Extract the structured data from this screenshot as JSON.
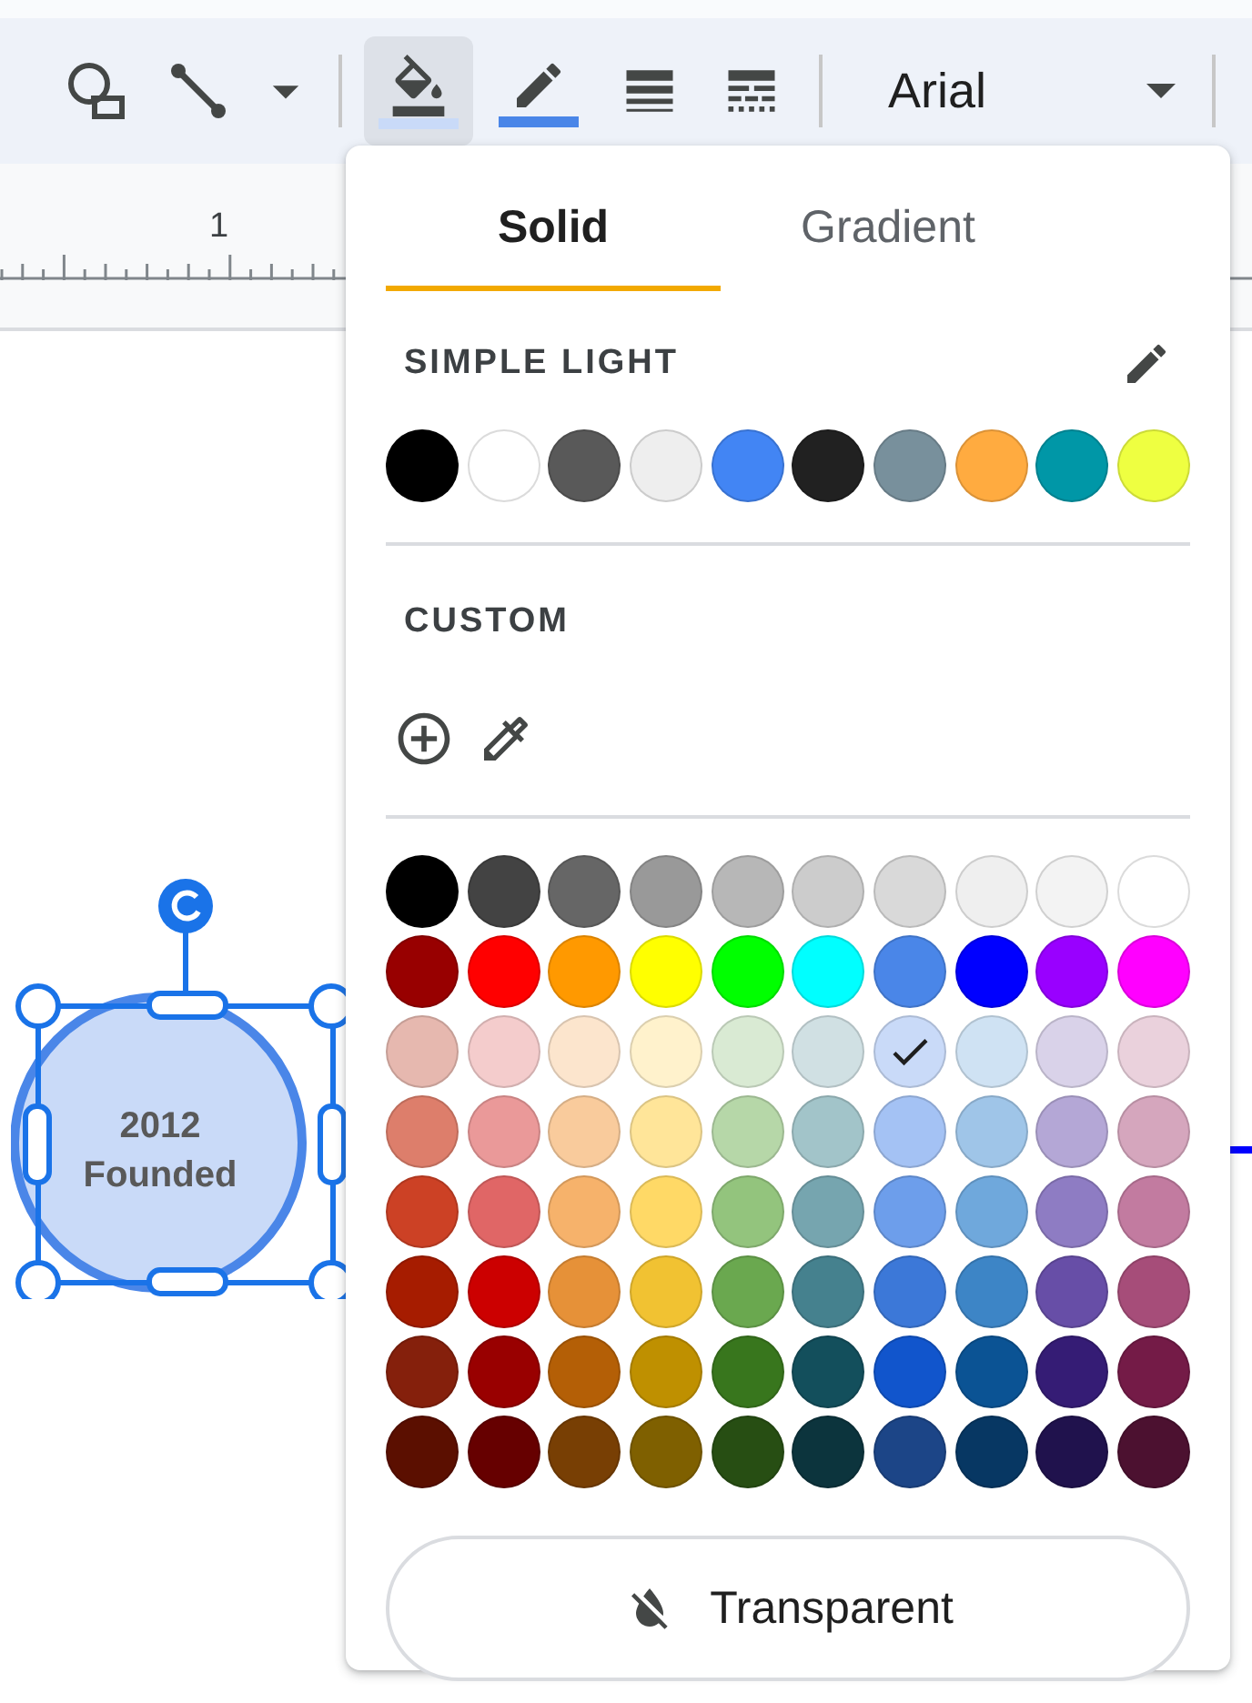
{
  "toolbar": {
    "fill_button": {
      "active": true
    },
    "font": "Arial"
  },
  "ruler": {
    "labels": [
      "1"
    ]
  },
  "shape": {
    "lines": [
      "2012",
      "Founded"
    ],
    "selected": true
  },
  "fill_popup": {
    "tabs": [
      {
        "label": "Solid",
        "selected": true
      },
      {
        "label": "Gradient",
        "selected": false
      }
    ],
    "theme": {
      "title": "SIMPLE LIGHT",
      "colors": [
        {
          "color": "#000000"
        },
        {
          "color": "#ffffff"
        },
        {
          "color": "#595959"
        },
        {
          "color": "#eeeeee"
        },
        {
          "color": "#4285f4"
        },
        {
          "color": "#212121"
        },
        {
          "color": "#78909c"
        },
        {
          "color": "#ffab40"
        },
        {
          "color": "#0097a7"
        },
        {
          "color": "#eeff41"
        }
      ]
    },
    "custom": {
      "title": "CUSTOM"
    },
    "palette": [
      {
        "colors": [
          {
            "color": "#000000",
            "selected": false
          },
          {
            "color": "#434343",
            "selected": false
          },
          {
            "color": "#666666",
            "selected": false
          },
          {
            "color": "#999999",
            "selected": false
          },
          {
            "color": "#b7b7b7",
            "selected": false
          },
          {
            "color": "#cccccc",
            "selected": false
          },
          {
            "color": "#d9d9d9",
            "selected": false
          },
          {
            "color": "#efefef",
            "selected": false
          },
          {
            "color": "#f3f3f3",
            "selected": false
          },
          {
            "color": "#ffffff",
            "selected": false
          }
        ]
      },
      {
        "colors": [
          {
            "color": "#980000",
            "selected": false
          },
          {
            "color": "#ff0000",
            "selected": false
          },
          {
            "color": "#ff9900",
            "selected": false
          },
          {
            "color": "#ffff00",
            "selected": false
          },
          {
            "color": "#00ff00",
            "selected": false
          },
          {
            "color": "#00ffff",
            "selected": false
          },
          {
            "color": "#4a86e8",
            "selected": false
          },
          {
            "color": "#0000ff",
            "selected": false
          },
          {
            "color": "#9900ff",
            "selected": false
          },
          {
            "color": "#ff00ff",
            "selected": false
          }
        ]
      },
      {
        "colors": [
          {
            "color": "#e6b8af",
            "selected": false
          },
          {
            "color": "#f4cccc",
            "selected": false
          },
          {
            "color": "#fce5cd",
            "selected": false
          },
          {
            "color": "#fff2cc",
            "selected": false
          },
          {
            "color": "#d9ead3",
            "selected": false
          },
          {
            "color": "#d0e0e3",
            "selected": false
          },
          {
            "color": "#c9daf8",
            "selected": true
          },
          {
            "color": "#cfe2f3",
            "selected": false
          },
          {
            "color": "#d9d2e9",
            "selected": false
          },
          {
            "color": "#ead1dc",
            "selected": false
          }
        ]
      },
      {
        "colors": [
          {
            "color": "#dd7e6b",
            "selected": false
          },
          {
            "color": "#ea9999",
            "selected": false
          },
          {
            "color": "#f9cb9c",
            "selected": false
          },
          {
            "color": "#ffe599",
            "selected": false
          },
          {
            "color": "#b6d7a8",
            "selected": false
          },
          {
            "color": "#a2c4c9",
            "selected": false
          },
          {
            "color": "#a4c2f4",
            "selected": false
          },
          {
            "color": "#9fc5e8",
            "selected": false
          },
          {
            "color": "#b4a7d6",
            "selected": false
          },
          {
            "color": "#d5a6bd",
            "selected": false
          }
        ]
      },
      {
        "colors": [
          {
            "color": "#cc4125",
            "selected": false
          },
          {
            "color": "#e06666",
            "selected": false
          },
          {
            "color": "#f6b26b",
            "selected": false
          },
          {
            "color": "#ffd966",
            "selected": false
          },
          {
            "color": "#93c47d",
            "selected": false
          },
          {
            "color": "#76a5af",
            "selected": false
          },
          {
            "color": "#6d9eeb",
            "selected": false
          },
          {
            "color": "#6fa8dc",
            "selected": false
          },
          {
            "color": "#8e7cc3",
            "selected": false
          },
          {
            "color": "#c27ba0",
            "selected": false
          }
        ]
      },
      {
        "colors": [
          {
            "color": "#a61c00",
            "selected": false
          },
          {
            "color": "#cc0000",
            "selected": false
          },
          {
            "color": "#e69138",
            "selected": false
          },
          {
            "color": "#f1c232",
            "selected": false
          },
          {
            "color": "#6aa84f",
            "selected": false
          },
          {
            "color": "#45818e",
            "selected": false
          },
          {
            "color": "#3c78d8",
            "selected": false
          },
          {
            "color": "#3d85c6",
            "selected": false
          },
          {
            "color": "#674ea7",
            "selected": false
          },
          {
            "color": "#a64d79",
            "selected": false
          }
        ]
      },
      {
        "colors": [
          {
            "color": "#85200c",
            "selected": false
          },
          {
            "color": "#990000",
            "selected": false
          },
          {
            "color": "#b45f06",
            "selected": false
          },
          {
            "color": "#bf9000",
            "selected": false
          },
          {
            "color": "#38761d",
            "selected": false
          },
          {
            "color": "#134f5c",
            "selected": false
          },
          {
            "color": "#1155cc",
            "selected": false
          },
          {
            "color": "#0b5394",
            "selected": false
          },
          {
            "color": "#351c75",
            "selected": false
          },
          {
            "color": "#741b47",
            "selected": false
          }
        ]
      },
      {
        "colors": [
          {
            "color": "#5b0f00",
            "selected": false
          },
          {
            "color": "#660000",
            "selected": false
          },
          {
            "color": "#783f04",
            "selected": false
          },
          {
            "color": "#7f6000",
            "selected": false
          },
          {
            "color": "#274e13",
            "selected": false
          },
          {
            "color": "#0c343d",
            "selected": false
          },
          {
            "color": "#1c4587",
            "selected": false
          },
          {
            "color": "#073763",
            "selected": false
          },
          {
            "color": "#20124d",
            "selected": false
          },
          {
            "color": "#4c1130",
            "selected": false
          }
        ]
      }
    ],
    "transparent_button": "Transparent"
  }
}
